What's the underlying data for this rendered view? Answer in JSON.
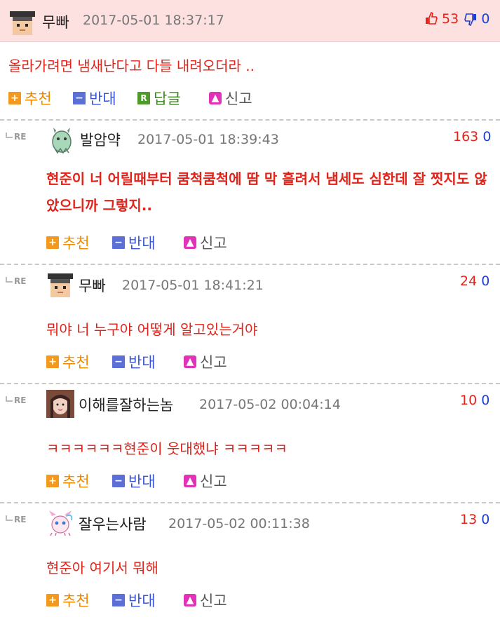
{
  "top": {
    "nick": "무빠",
    "date": "2017-05-01 18:37:17",
    "up": "53",
    "down": "0",
    "text": "올라가려면 냄새난다고 다들 내려오더라 ..",
    "actions": {
      "up": "추천",
      "down": "반대",
      "reply": "답글",
      "report": "신고"
    }
  },
  "replies": [
    {
      "re": "RE",
      "nick": "발암약",
      "date": "2017-05-01 18:39:43",
      "up": "163",
      "down": "0",
      "text": "현준이 너 어릴때부터 쿰척쿰척에 땀 막 흘려서 냄세도 심한데 잘 찟지도 않았으니까 그렇지..",
      "bold": true
    },
    {
      "re": "RE",
      "nick": "무빠",
      "date": "2017-05-01 18:41:21",
      "up": "24",
      "down": "0",
      "text": "뭐야 너 누구야 어떻게 알고있는거야",
      "bold": false
    },
    {
      "re": "RE",
      "nick": "이해를잘하는놈",
      "date": "2017-05-02 00:04:14",
      "up": "10",
      "down": "0",
      "text": "ㅋㅋㅋㅋㅋㅋ현준이 웃대했냐 ㅋㅋㅋㅋㅋ",
      "bold": false
    },
    {
      "re": "RE",
      "nick": "잘우는사람",
      "date": "2017-05-02 00:11:38",
      "up": "13",
      "down": "0",
      "text": "현준아 여기서 뭐해",
      "bold": false
    }
  ],
  "reply_actions": {
    "up": "추천",
    "down": "반대",
    "report": "신고"
  },
  "colors": {
    "accent_red": "#e2231a",
    "accent_blue": "#1e3fd6",
    "header_bg": "#fde0e0"
  },
  "icons": {
    "thumb_up": "thumbs-up-icon",
    "thumb_down": "thumbs-down-icon"
  }
}
